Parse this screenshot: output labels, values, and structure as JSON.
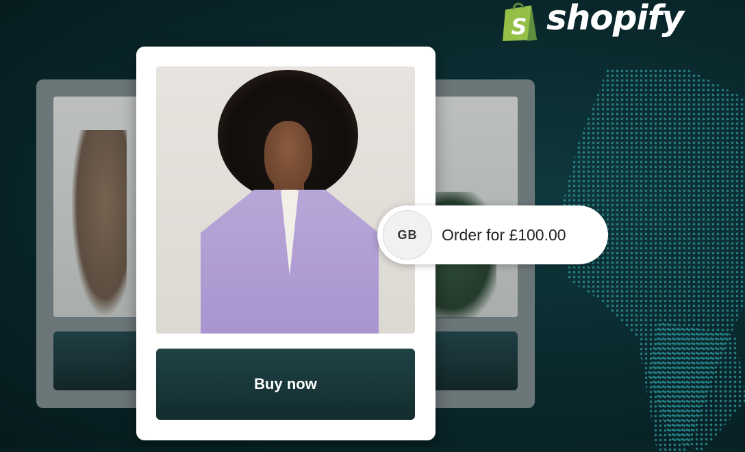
{
  "brand": {
    "name": "shopify",
    "logo_icon": "shopify-bag-icon",
    "bag_letter": "S",
    "bag_color": "#95bf47"
  },
  "product_card": {
    "image": "model-in-lavender-cardigan",
    "buy_button_label": "Buy now"
  },
  "order_notification": {
    "country_code": "GB",
    "text": "Order for £100.00"
  },
  "colors": {
    "background": "#0a2a2e",
    "button": "#1a3a3d",
    "map_dots": "#2a8c92"
  }
}
